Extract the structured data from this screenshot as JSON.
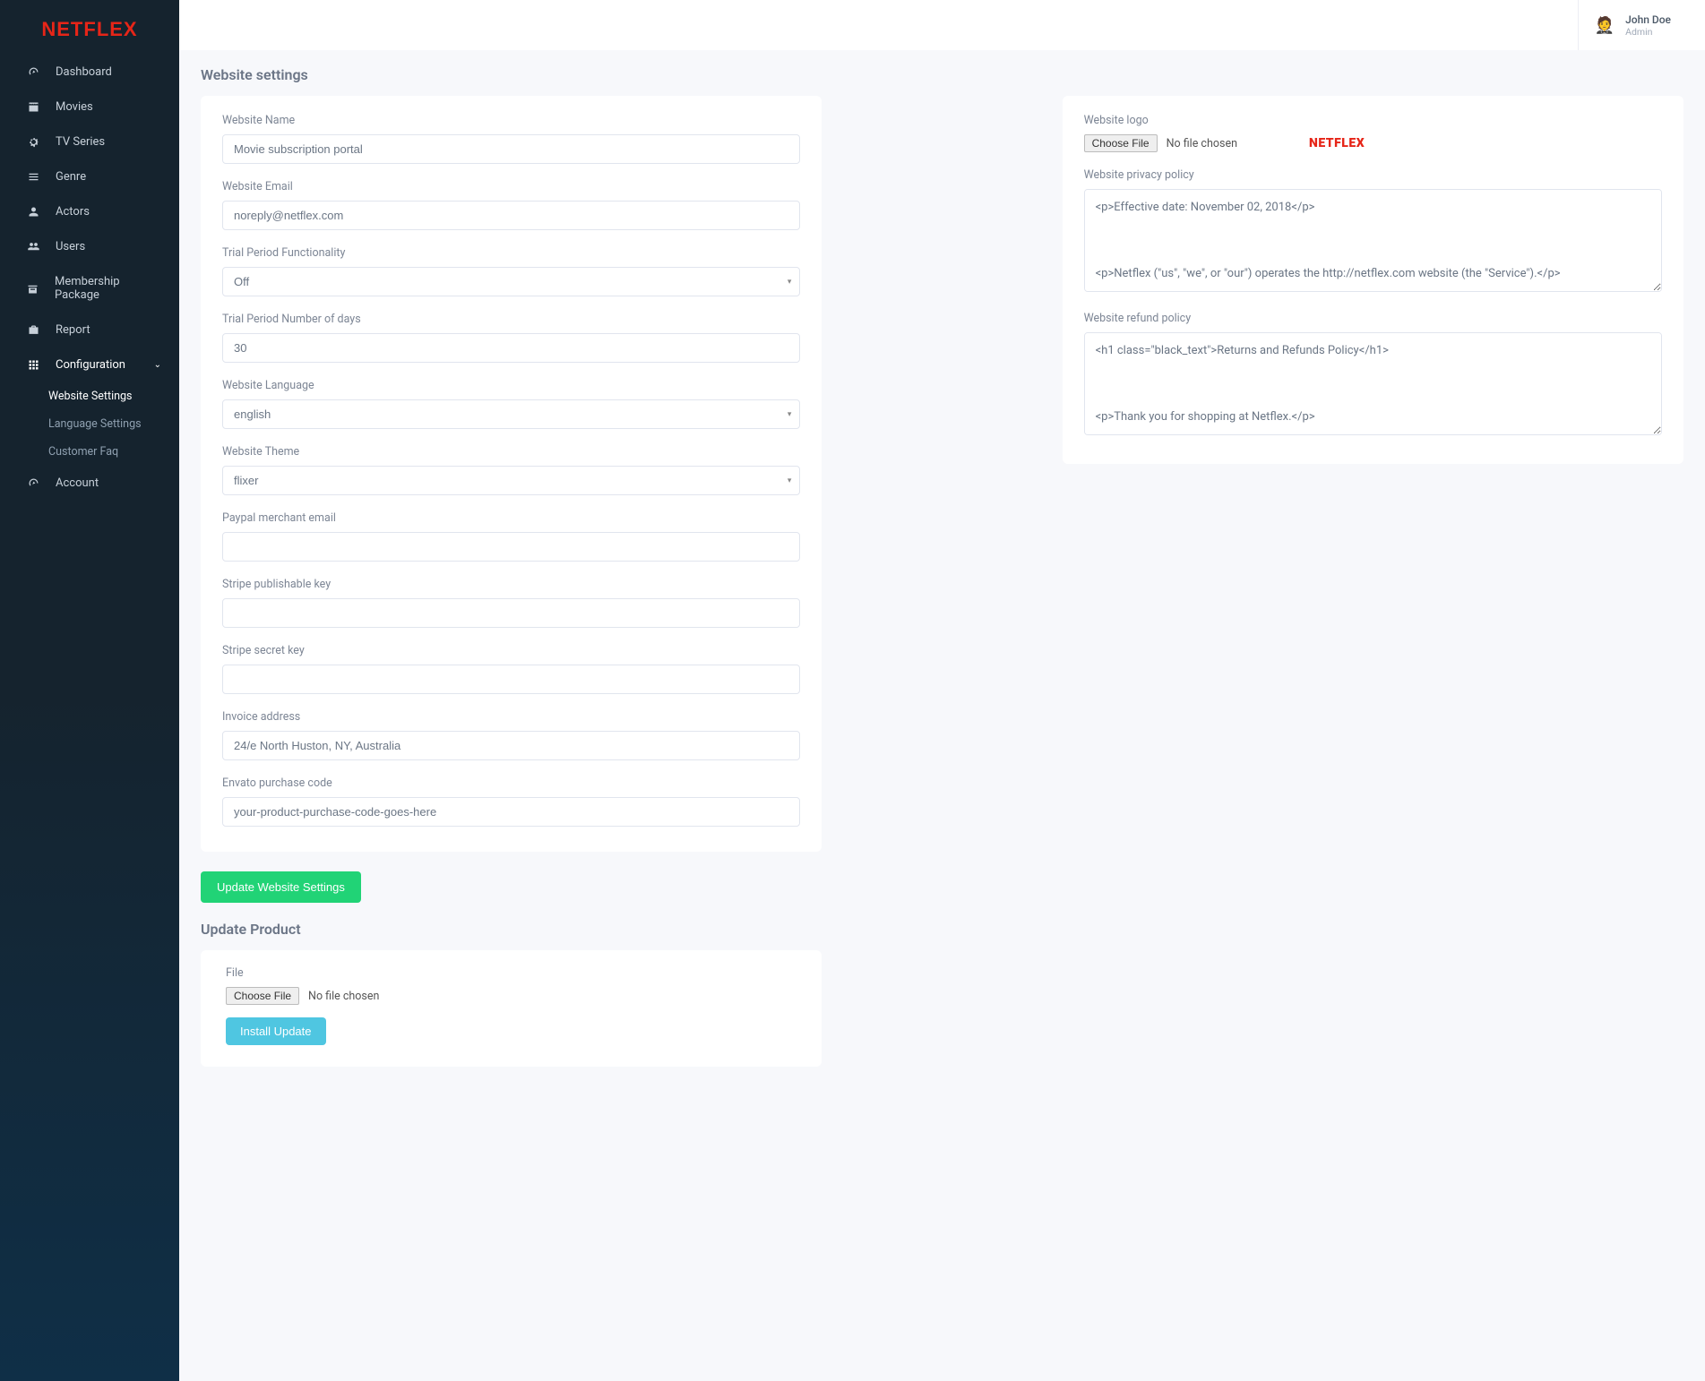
{
  "brand": "NETFLEX",
  "user": {
    "name": "John Doe",
    "role": "Admin"
  },
  "sidebar": {
    "items": [
      {
        "label": "Dashboard"
      },
      {
        "label": "Movies"
      },
      {
        "label": "TV Series"
      },
      {
        "label": "Genre"
      },
      {
        "label": "Actors"
      },
      {
        "label": "Users"
      },
      {
        "label": "Membership Package"
      },
      {
        "label": "Report"
      },
      {
        "label": "Configuration"
      },
      {
        "label": "Account"
      }
    ],
    "sub": [
      {
        "label": "Website Settings"
      },
      {
        "label": "Language Settings"
      },
      {
        "label": "Customer Faq"
      }
    ]
  },
  "page": {
    "title": "Website settings",
    "updateTitle": "Update Product"
  },
  "form": {
    "nameLabel": "Website Name",
    "nameValue": "Movie subscription portal",
    "emailLabel": "Website Email",
    "emailValue": "noreply@netflex.com",
    "trialFnLabel": "Trial Period Functionality",
    "trialFnValue": "Off",
    "trialDaysLabel": "Trial Period Number of days",
    "trialDaysValue": "30",
    "langLabel": "Website Language",
    "langValue": "english",
    "themeLabel": "Website Theme",
    "themeValue": "flixer",
    "paypalLabel": "Paypal merchant email",
    "paypalValue": "",
    "stripePubLabel": "Stripe publishable key",
    "stripePubValue": "",
    "stripeSecLabel": "Stripe secret key",
    "stripeSecValue": "",
    "invoiceLabel": "Invoice address",
    "invoiceValue": "24/e North Huston, NY, Australia",
    "envatoLabel": "Envato purchase code",
    "envatoValue": "your-product-purchase-code-goes-here",
    "logoLabel": "Website logo",
    "logoPreview": "NETFLEX",
    "privacyLabel": "Website privacy policy",
    "privacyValue": "<p>Effective date: November 02, 2018</p>\n\n\n<p>Netflex (\"us\", \"we\", or \"our\") operates the http://netflex.com website (the \"Service\").</p>\n\n<p>This page informs you of our policies regarding the collection, use, and disclosure of personal data when ",
    "refundLabel": "Website refund policy",
    "refundValue": "<h1 class=\"black_text\">Returns and Refunds Policy</h1>\n\n\n<p>Thank you for shopping at Netflex.</p>\n\n<p>Please read this policy carefully. This is the Return and Refund Policy of Netflex. This Return and Refund ",
    "chooseFile": "Choose File",
    "noFile": "No file chosen",
    "fileLabel": "File"
  },
  "buttons": {
    "updateSettings": "Update Website Settings",
    "installUpdate": "Install Update"
  }
}
